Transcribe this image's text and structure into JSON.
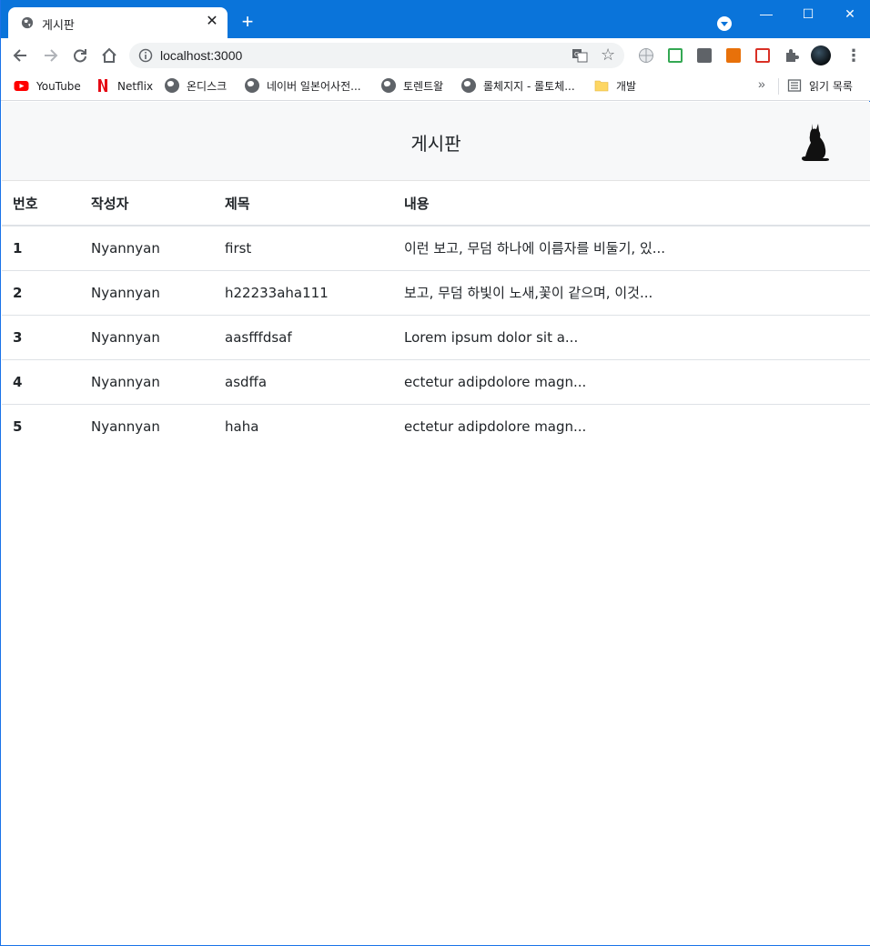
{
  "browser": {
    "tab_title": "게시판",
    "new_tab_symbol": "+",
    "url": "localhost:3000",
    "window_controls": {
      "minimize": "—",
      "maximize": "☐",
      "close": "✕"
    }
  },
  "bookmarks": [
    {
      "label": "YouTube",
      "icon": "youtube-icon"
    },
    {
      "label": "Netflix",
      "icon": "netflix-icon"
    },
    {
      "label": "온디스크",
      "icon": "globe-icon"
    },
    {
      "label": "네이버 일본어사전...",
      "icon": "globe-icon"
    },
    {
      "label": "토렌트왈",
      "icon": "globe-icon"
    },
    {
      "label": "롤체지지 - 롤토체...",
      "icon": "globe-icon"
    },
    {
      "label": "개발",
      "icon": "folder-icon"
    }
  ],
  "reading_list": "읽기 목록",
  "more_bookmarks": "»",
  "page": {
    "title": "게시판",
    "table": {
      "headers": [
        "번호",
        "작성자",
        "제목",
        "내용"
      ],
      "rows": [
        {
          "id": "1",
          "author": "Nyannyan",
          "title": "first",
          "content": "이런 보고, 무덤 하나에 이름자를 비둘기, 있..."
        },
        {
          "id": "2",
          "author": "Nyannyan",
          "title": "h22233aha111",
          "content": "보고, 무덤 하빛이 노새,꽃이 같으며, 이것..."
        },
        {
          "id": "3",
          "author": "Nyannyan",
          "title": "aasfffdsaf",
          "content": "Lorem ipsum dolor sit a..."
        },
        {
          "id": "4",
          "author": "Nyannyan",
          "title": "asdffa",
          "content": "ectetur adipdolore magn..."
        },
        {
          "id": "5",
          "author": "Nyannyan",
          "title": "haha",
          "content": "ectetur adipdolore magn..."
        }
      ]
    }
  },
  "colors": {
    "titlebar": "#0a74da",
    "header_bg": "#f7f8f9",
    "text": "#212529"
  }
}
